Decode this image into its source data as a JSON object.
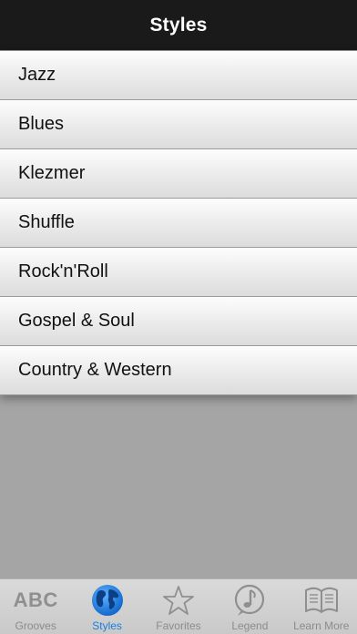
{
  "navbar": {
    "title": "Styles"
  },
  "styles": [
    {
      "label": "Jazz"
    },
    {
      "label": "Blues"
    },
    {
      "label": "Klezmer"
    },
    {
      "label": "Shuffle"
    },
    {
      "label": "Rock'n'Roll"
    },
    {
      "label": "Gospel & Soul"
    },
    {
      "label": "Country & Western"
    }
  ],
  "tabbar": {
    "tabs": [
      {
        "label": "Grooves",
        "icon": "abc-icon",
        "icon_text": "ABC",
        "active": false
      },
      {
        "label": "Styles",
        "icon": "globe-icon",
        "active": true
      },
      {
        "label": "Favorites",
        "icon": "star-icon",
        "active": false
      },
      {
        "label": "Legend",
        "icon": "music-note-icon",
        "active": false
      },
      {
        "label": "Learn More",
        "icon": "book-icon",
        "active": false
      }
    ]
  },
  "colors": {
    "navbar_bg": "#1a1a1a",
    "active_tab": "#1a7fe0",
    "inactive_tab": "#8c8c8c",
    "background": "#a5a5a5"
  }
}
